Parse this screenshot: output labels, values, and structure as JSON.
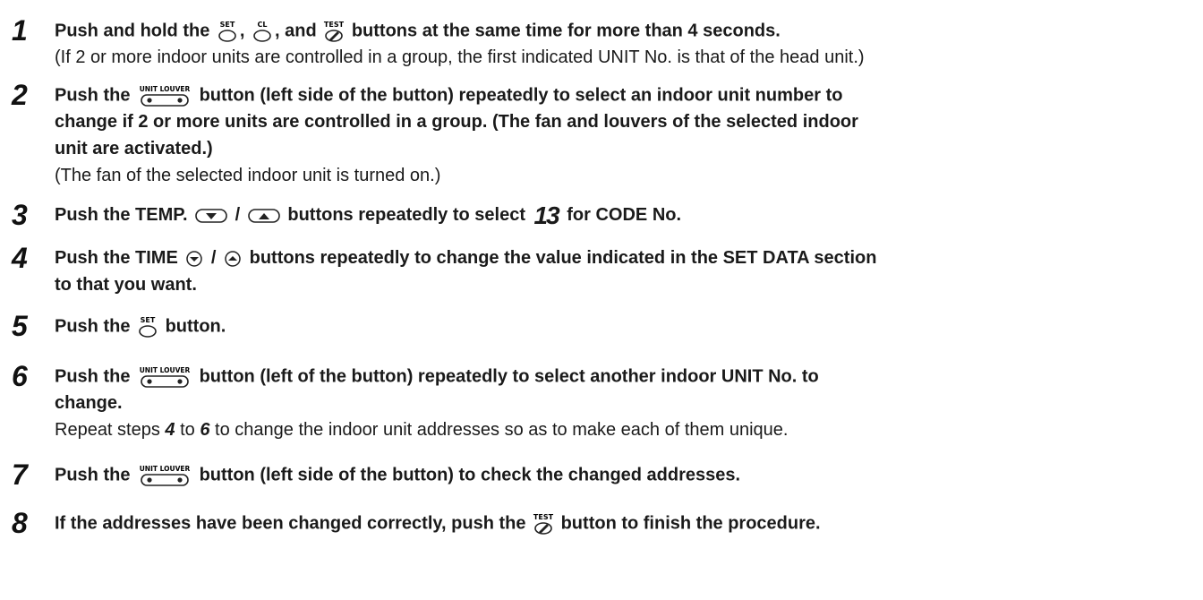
{
  "icons": {
    "set_label": "SET",
    "cl_label": "CL",
    "test_label": "TEST",
    "unit_louver_label": "UNIT LOUVER",
    "code_display": "13"
  },
  "steps": [
    {
      "number": "1",
      "parts": {
        "a": "Push and hold the",
        "b": ",",
        "c": ", and",
        "d": "buttons at the same time for more than 4 seconds."
      },
      "note": "(If 2 or more indoor units are controlled in a group, the first indicated UNIT No. is that of the head unit.)"
    },
    {
      "number": "2",
      "parts": {
        "a": "Push the",
        "b": "button (left side of the button) repeatedly to select an indoor unit number to"
      },
      "line2": "change if 2 or more units are controlled in a group. (The fan and louvers of the selected indoor",
      "line3": "unit are activated.)",
      "note": "(The fan of the selected indoor unit is turned on.)"
    },
    {
      "number": "3",
      "parts": {
        "a": "Push the TEMP.",
        "b": "/",
        "c": "buttons repeatedly to select",
        "d": "for CODE No."
      }
    },
    {
      "number": "4",
      "parts": {
        "a": "Push the TIME",
        "b": "/",
        "c": "buttons repeatedly to change the value indicated in the SET DATA section"
      },
      "line2": "to that you want."
    },
    {
      "number": "5",
      "parts": {
        "a": "Push the",
        "b": "button."
      }
    },
    {
      "number": "6",
      "parts": {
        "a": "Push the",
        "b": "button (left of the button) repeatedly to select another indoor UNIT No. to"
      },
      "line2": "change.",
      "repeat": {
        "a": "Repeat steps",
        "from": "4",
        "b": "to",
        "to": "6",
        "c": "to change the indoor unit addresses so as to make each of them unique."
      }
    },
    {
      "number": "7",
      "parts": {
        "a": "Push the",
        "b": "button (left side of the button) to check the changed addresses."
      }
    },
    {
      "number": "8",
      "parts": {
        "a": "If the addresses have been changed correctly, push the",
        "b": "button to finish the procedure."
      }
    }
  ]
}
